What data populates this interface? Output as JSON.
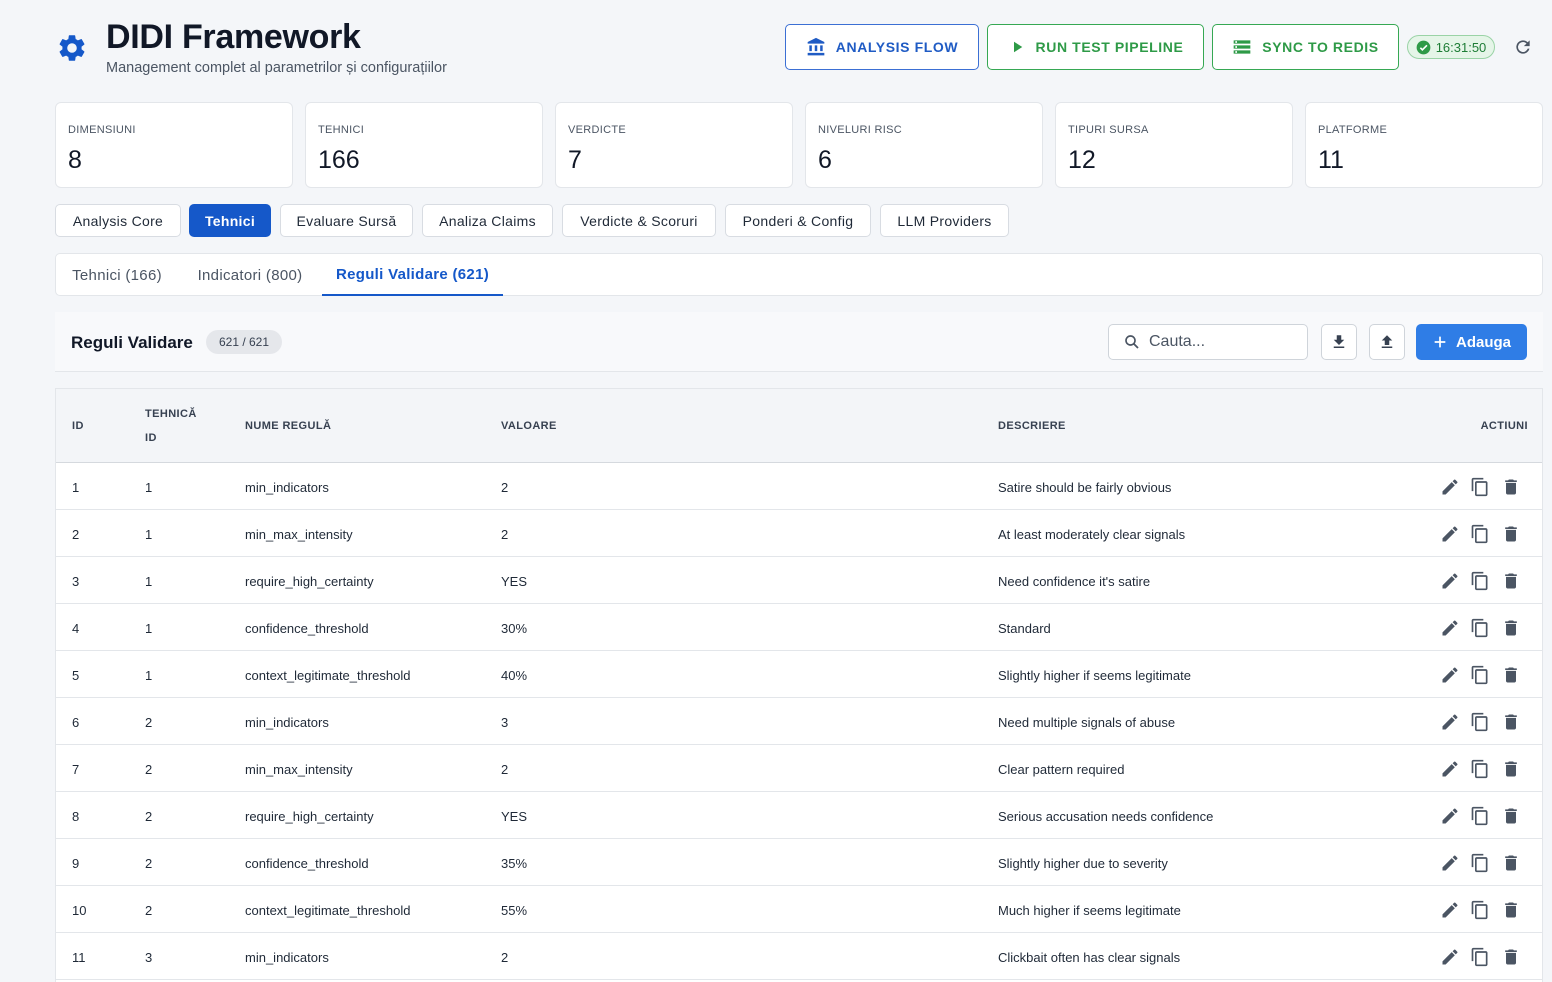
{
  "header": {
    "title": "DIDI Framework",
    "subtitle": "Management complet al parametrilor și configurațiilor",
    "buttons": {
      "analysis_flow": "ANALYSIS FLOW",
      "run_test_pipeline": "RUN TEST PIPELINE",
      "sync_to_redis": "SYNC TO REDIS"
    },
    "time": "16:31:50",
    "colors": {
      "primary": "#1558c9",
      "success": "#2e9a47",
      "add": "#2f7de6"
    }
  },
  "stats": [
    {
      "label": "DIMENSIUNI",
      "value": "8"
    },
    {
      "label": "TEHNICI",
      "value": "166"
    },
    {
      "label": "VERDICTE",
      "value": "7"
    },
    {
      "label": "NIVELURI RISC",
      "value": "6"
    },
    {
      "label": "TIPURI SURSA",
      "value": "12"
    },
    {
      "label": "PLATFORME",
      "value": "11"
    }
  ],
  "main_tabs": [
    {
      "label": "Analysis Core",
      "active": false
    },
    {
      "label": "Tehnici",
      "active": true
    },
    {
      "label": "Evaluare Sursă",
      "active": false
    },
    {
      "label": "Analiza Claims",
      "active": false
    },
    {
      "label": "Verdicte & Scoruri",
      "active": false
    },
    {
      "label": "Ponderi & Config",
      "active": false
    },
    {
      "label": "LLM Providers",
      "active": false
    }
  ],
  "sub_tabs": [
    {
      "label": "Tehnici (166)",
      "active": false
    },
    {
      "label": "Indicatori (800)",
      "active": false
    },
    {
      "label": "Reguli Validare (621)",
      "active": true
    }
  ],
  "panel": {
    "title": "Reguli Validare",
    "count": "621 / 621",
    "search_placeholder": "Cauta...",
    "add_label": "Adauga"
  },
  "table": {
    "headers": {
      "id": "ID",
      "technique_id_line1": "TEHNICĂ",
      "technique_id_line2": "ID",
      "rule_name": "NUME REGULĂ",
      "value": "VALOARE",
      "description": "DESCRIERE",
      "actions": "ACTIUNI"
    },
    "rows": [
      {
        "id": "1",
        "tech_id": "1",
        "name": "min_indicators",
        "value": "2",
        "description": "Satire should be fairly obvious"
      },
      {
        "id": "2",
        "tech_id": "1",
        "name": "min_max_intensity",
        "value": "2",
        "description": "At least moderately clear signals"
      },
      {
        "id": "3",
        "tech_id": "1",
        "name": "require_high_certainty",
        "value": "YES",
        "description": "Need confidence it's satire"
      },
      {
        "id": "4",
        "tech_id": "1",
        "name": "confidence_threshold",
        "value": "30%",
        "description": "Standard"
      },
      {
        "id": "5",
        "tech_id": "1",
        "name": "context_legitimate_threshold",
        "value": "40%",
        "description": "Slightly higher if seems legitimate"
      },
      {
        "id": "6",
        "tech_id": "2",
        "name": "min_indicators",
        "value": "3",
        "description": "Need multiple signals of abuse"
      },
      {
        "id": "7",
        "tech_id": "2",
        "name": "min_max_intensity",
        "value": "2",
        "description": "Clear pattern required"
      },
      {
        "id": "8",
        "tech_id": "2",
        "name": "require_high_certainty",
        "value": "YES",
        "description": "Serious accusation needs confidence"
      },
      {
        "id": "9",
        "tech_id": "2",
        "name": "confidence_threshold",
        "value": "35%",
        "description": "Slightly higher due to severity"
      },
      {
        "id": "10",
        "tech_id": "2",
        "name": "context_legitimate_threshold",
        "value": "55%",
        "description": "Much higher if seems legitimate"
      },
      {
        "id": "11",
        "tech_id": "3",
        "name": "min_indicators",
        "value": "2",
        "description": "Clickbait often has clear signals"
      }
    ]
  }
}
